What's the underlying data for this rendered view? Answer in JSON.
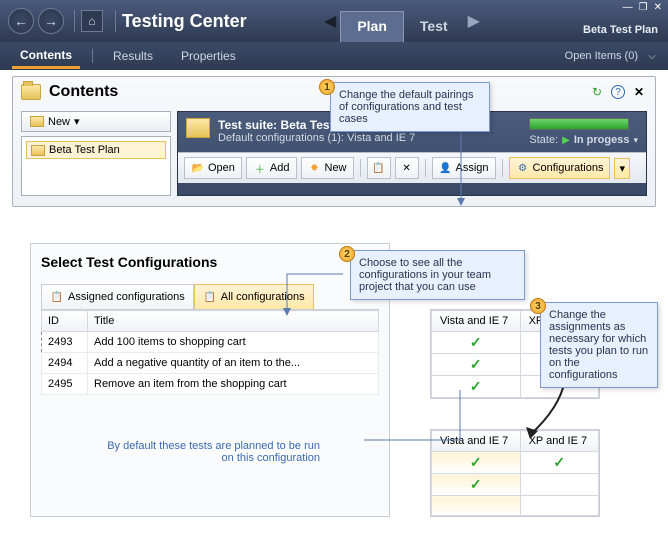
{
  "header": {
    "app_title": "Testing Center",
    "tabs": [
      "Plan",
      "Test"
    ],
    "active_tab": "Plan",
    "plan_name": "Beta Test Plan",
    "window_controls": {
      "min": "—",
      "restore": "❐",
      "close": "✕"
    }
  },
  "subtabs": {
    "items": [
      "Contents",
      "Results",
      "Properties"
    ],
    "active": "Contents",
    "open_items_label": "Open Items (0)"
  },
  "contents": {
    "title": "Contents",
    "new_btn": "New",
    "tree_item": "Beta Test Plan",
    "suite_title": "Test suite:  Beta Test Plan (ID: 10)",
    "suite_sub": "Default configurations (1): Vista and IE 7",
    "state_label": "State:",
    "state_value": "In progess",
    "toolbar": {
      "open": "Open",
      "add": "Add",
      "new": "New",
      "assign": "Assign",
      "configurations": "Configurations"
    }
  },
  "callouts": {
    "c1": "Change the default pairings of configurations and test cases",
    "c2": "Choose to see all the configurations in your team project that you can use",
    "c3": "Change the assignments as necessary for which tests you plan to run on the configurations"
  },
  "select_panel": {
    "title": "Select Test Configurations",
    "tab_assigned": "Assigned configurations",
    "tab_all": "All configurations",
    "cols": {
      "id": "ID",
      "title": "Title"
    },
    "rows": [
      {
        "id": "2493",
        "title": "Add 100 items to shopping cart"
      },
      {
        "id": "2494",
        "title": "Add a negative quantity of an item to the..."
      },
      {
        "id": "2495",
        "title": "Remove an item from the shopping cart"
      }
    ],
    "footnote": "By default these tests are planned to be run on this configuration"
  },
  "cfg_cols": {
    "c1": "Vista and IE 7",
    "c2": "XP and IE 7"
  },
  "grid1": [
    [
      true,
      false
    ],
    [
      true,
      false
    ],
    [
      true,
      false
    ]
  ],
  "grid2": [
    [
      true,
      true
    ],
    [
      true,
      false
    ],
    [
      false,
      false
    ]
  ]
}
